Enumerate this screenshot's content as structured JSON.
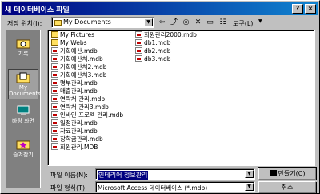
{
  "window": {
    "title": "새 데이터베이스 파일"
  },
  "toolbar": {
    "location_label": "저장 위치(I):",
    "location_value": "My Documents",
    "tools_label": "도구(L)"
  },
  "places": [
    {
      "label": "기록",
      "icon": "history-folder-icon"
    },
    {
      "label": "My Documents",
      "icon": "my-documents-icon"
    },
    {
      "label": "바탕 화면",
      "icon": "desktop-icon"
    },
    {
      "label": "즐겨찾기",
      "icon": "favorites-icon"
    }
  ],
  "files_col1": [
    {
      "name": "My Pictures",
      "type": "folder"
    },
    {
      "name": "My Webs",
      "type": "folder"
    },
    {
      "name": "기획예산.mdb",
      "type": "mdb"
    },
    {
      "name": "기획예산처.mdb",
      "type": "mdb"
    },
    {
      "name": "기획예산처2.mdb",
      "type": "mdb"
    },
    {
      "name": "기획예산처3.mdb",
      "type": "mdb"
    },
    {
      "name": "명부관리.mdb",
      "type": "mdb"
    },
    {
      "name": "매출관리.mdb",
      "type": "mdb"
    },
    {
      "name": "연락처 관리.mdb",
      "type": "mdb"
    },
    {
      "name": "연락처 관리3.mdb",
      "type": "mdb"
    },
    {
      "name": "인바인 프로젝 관리.mdb",
      "type": "mdb"
    },
    {
      "name": "일정관리.mdb",
      "type": "mdb"
    },
    {
      "name": "자료관리.mdb",
      "type": "mdb"
    },
    {
      "name": "장학금관리.mdb",
      "type": "mdb"
    },
    {
      "name": "회원관리.MDB",
      "type": "mdb"
    }
  ],
  "files_col2": [
    {
      "name": "회원관리2000.mdb",
      "type": "mdb"
    },
    {
      "name": "db1.mdb",
      "type": "mdb"
    },
    {
      "name": "db2.mdb",
      "type": "mdb"
    },
    {
      "name": "db3.mdb",
      "type": "mdb"
    }
  ],
  "form": {
    "filename_label": "파일 이름(N):",
    "filename_value": "인테리어 정보관리",
    "filetype_label": "파일 형식(T):",
    "filetype_value": "Microsoft Access 데이터베이스 (*.mdb)",
    "create_button": "만들기(C)",
    "cancel_button": "취소"
  },
  "colors": {
    "title_start": "#000080",
    "title_end": "#1084d0",
    "face": "#c0c0c0",
    "places_bg": "#808080"
  }
}
